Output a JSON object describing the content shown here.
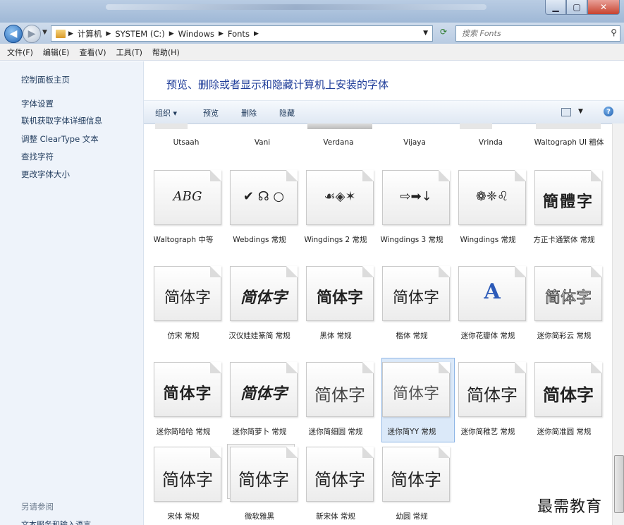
{
  "address": {
    "crumbs": [
      "计算机",
      "SYSTEM (C:)",
      "Windows",
      "Fonts"
    ],
    "search_placeholder": "搜索 Fonts"
  },
  "menu": [
    "文件(F)",
    "编辑(E)",
    "查看(V)",
    "工具(T)",
    "帮助(H)"
  ],
  "sidebar": {
    "home": "控制面板主页",
    "links": [
      "字体设置",
      "联机获取字体详细信息",
      "调整 ClearType 文本",
      "查找字符",
      "更改字体大小"
    ],
    "see_also": "另请参阅",
    "bottom": "文本服务和输入语言"
  },
  "header": {
    "title": "预览、删除或者显示和隐藏计算机上安装的字体"
  },
  "commands": {
    "organize": "组织 ▾",
    "preview": "预览",
    "delete": "删除",
    "hide": "隐藏"
  },
  "top_row": [
    "Utsaah",
    "Vani",
    "Verdana",
    "Vijaya",
    "Vrinda",
    "Waltograph UI 粗体"
  ],
  "fonts": [
    {
      "name": "Waltograph 中等",
      "sample": "ABG"
    },
    {
      "name": "Webdings 常规",
      "sample": "✔ ☊ ○"
    },
    {
      "name": "Wingdings 2 常规",
      "sample": "☙◈✶"
    },
    {
      "name": "Wingdings 3 常规",
      "sample": "⇨➡↓"
    },
    {
      "name": "Wingdings 常规",
      "sample": "❁❈♌"
    },
    {
      "name": "方正卡通繁体 常规",
      "sample": "簡體字"
    },
    {
      "name": "仿宋 常规",
      "sample": "简体字"
    },
    {
      "name": "汉仪娃娃篆简 常规",
      "sample": "简体字"
    },
    {
      "name": "黑体 常规",
      "sample": "简体字"
    },
    {
      "name": "楷体 常规",
      "sample": "简体字"
    },
    {
      "name": "迷你花瓣体 常规",
      "sample": "A"
    },
    {
      "name": "迷你简彩云 常规",
      "sample": "简体字"
    },
    {
      "name": "迷你简哈哈 常规",
      "sample": "简体字"
    },
    {
      "name": "迷你简萝卜 常规",
      "sample": "简体字"
    },
    {
      "name": "迷你简细圆 常规",
      "sample": "简体字"
    },
    {
      "name": "迷你简YY 常规",
      "sample": "简体字"
    },
    {
      "name": "迷你简稚艺 常规",
      "sample": "简体字"
    },
    {
      "name": "迷你简准圆 常规",
      "sample": "简体字"
    },
    {
      "name": "宋体 常规",
      "sample": "简体字"
    },
    {
      "name": "微软雅黑",
      "sample": "简体字"
    },
    {
      "name": "新宋体 常规",
      "sample": "简体字"
    },
    {
      "name": "幼圆 常规",
      "sample": "简体字"
    }
  ],
  "watermark": "最需教育"
}
